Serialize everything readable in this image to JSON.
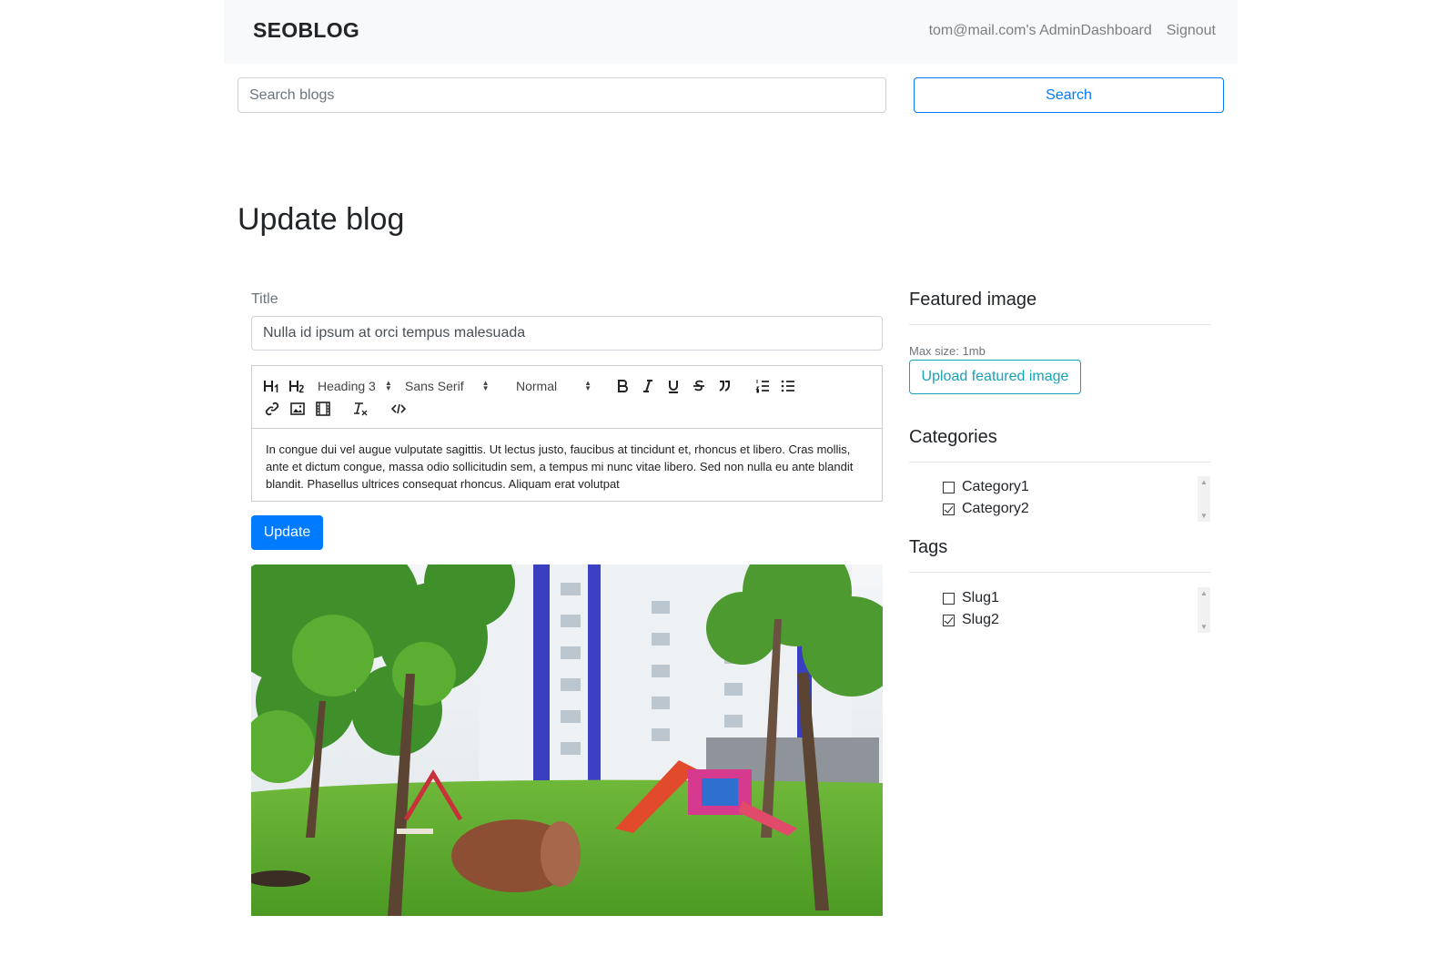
{
  "navbar": {
    "brand": "SEOBLOG",
    "dashboard_link": "tom@mail.com's AdminDashboard",
    "signout_link": "Signout"
  },
  "search": {
    "placeholder": "Search blogs",
    "button_label": "Search"
  },
  "page": {
    "title": "Update blog"
  },
  "form": {
    "title_label": "Title",
    "title_value": "Nulla id ipsum at orci tempus malesuada",
    "editor": {
      "toolbar": {
        "h1": "H1",
        "h2": "H2",
        "heading_picker": "Heading 3",
        "font_picker": "Sans Serif",
        "size_picker": "Normal"
      },
      "body": "In congue dui vel augue vulputate sagittis. Ut lectus justo, faucibus at tincidunt et, rhoncus et libero. Cras mollis, ante et dictum congue, massa odio sollicitudin sem, a tempus mi nunc vitae libero. Sed non nulla eu ante blandit blandit. Phasellus ultrices consequat rhoncus. Aliquam erat volutpat"
    },
    "update_label": "Update"
  },
  "sidebar": {
    "featured_heading": "Featured image",
    "max_size": "Max size: 1mb",
    "upload_label": "Upload featured image",
    "categories_heading": "Categories",
    "categories": [
      {
        "label": "Category1",
        "checked": false
      },
      {
        "label": "Category2",
        "checked": true
      }
    ],
    "tags_heading": "Tags",
    "tags": [
      {
        "label": "Slug1",
        "checked": false
      },
      {
        "label": "Slug2",
        "checked": true
      }
    ]
  },
  "colors": {
    "primary": "#007bff",
    "info": "#17a2b8",
    "navbar_bg": "#f8f9fa"
  }
}
